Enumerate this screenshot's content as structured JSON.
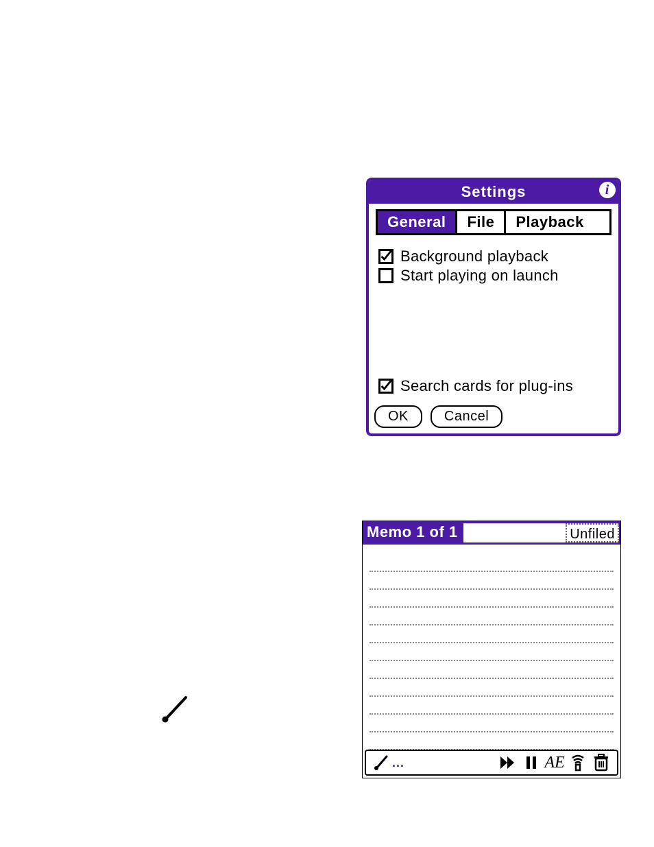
{
  "settings": {
    "title": "Settings",
    "tabs": [
      {
        "label": "General",
        "active": true
      },
      {
        "label": "File",
        "active": false
      },
      {
        "label": "Playback",
        "active": false
      }
    ],
    "options": {
      "background_playback": {
        "label": "Background playback",
        "checked": true
      },
      "start_on_launch": {
        "label": "Start playing on launch",
        "checked": false
      },
      "search_plugins": {
        "label": "Search cards for plug-ins",
        "checked": true
      }
    },
    "buttons": {
      "ok": "OK",
      "cancel": "Cancel"
    }
  },
  "memo": {
    "title": "Memo 1 of 1",
    "category": "Unfiled",
    "line_count": 11,
    "toolbar": {
      "pen_dots": "...",
      "ae": "AE"
    }
  }
}
